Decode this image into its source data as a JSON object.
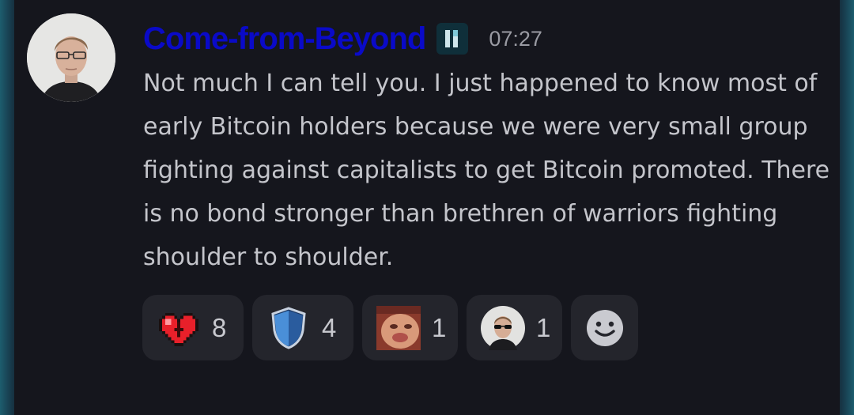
{
  "message": {
    "username": "Come-from-Beyond",
    "timestamp": "07:27",
    "text": "Not much I can tell you. I just happened to know most of early Bitcoin holders because we were very small group fighting against capitalists to get Bitcoin promoted. There is no bond stronger than brethren of warriors fighting shoulder to shoulder.",
    "username_color": "#0a0ac8"
  },
  "reactions": [
    {
      "icon": "pixel-heart-icon",
      "count": "8"
    },
    {
      "icon": "shield-icon",
      "count": "4"
    },
    {
      "icon": "face-emote-icon",
      "count": "1"
    },
    {
      "icon": "sunglasses-avatar-icon",
      "count": "1"
    }
  ],
  "add_reaction": {
    "icon": "smiley-add-reaction-icon"
  }
}
